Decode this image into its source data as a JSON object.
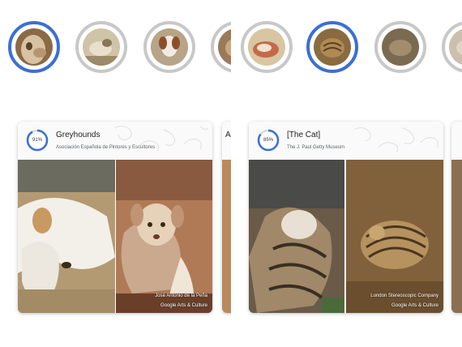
{
  "cards": [
    {
      "title": "Greyhounds",
      "source": "Asociación Española de Pintores y Escultores",
      "percent_label": "91%",
      "percent": 91,
      "credit": "José Antonio de la Peña",
      "brand": "Google Arts & Culture"
    },
    {
      "title": "[The Cat]",
      "source": "The J. Paul Getty Museum",
      "percent_label": "85%",
      "percent": 85,
      "credit": "London Stereoscopic Company",
      "brand": "Google Arts & Culture"
    }
  ],
  "partial_card_title_fragment": "A",
  "colors": {
    "accent": "#3b6fd4",
    "ring_inactive": "#c8c8c8"
  }
}
